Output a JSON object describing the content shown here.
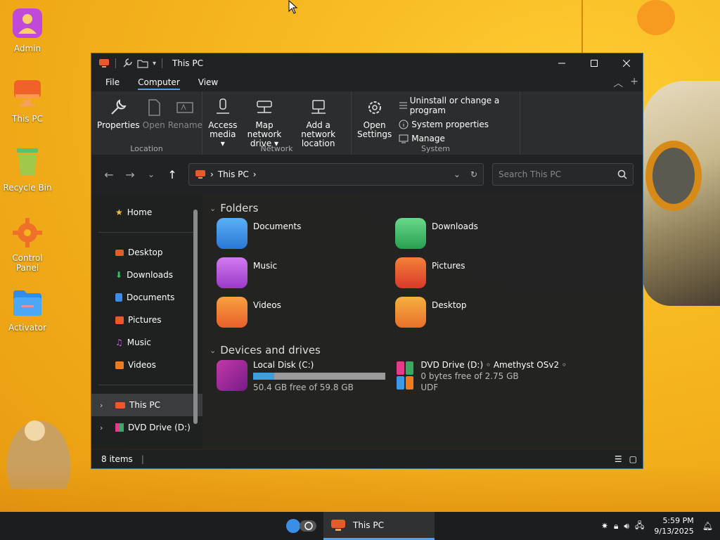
{
  "desktop": {
    "icons": [
      {
        "label": "Admin",
        "icon": "admin-user-icon"
      },
      {
        "label": "This PC",
        "icon": "computer-icon"
      },
      {
        "label": "Recycle Bin",
        "icon": "recycle-bin-icon"
      },
      {
        "label": "Control Panel",
        "icon": "control-panel-gear-icon"
      },
      {
        "label": "Activator",
        "icon": "folder-icon"
      }
    ]
  },
  "window": {
    "title": "This PC",
    "menu": {
      "file": "File",
      "computer": "Computer",
      "view": "View"
    },
    "ribbon": {
      "location": {
        "label": "Location",
        "properties": "Properties",
        "open": "Open",
        "rename": "Rename"
      },
      "network": {
        "label": "Network",
        "access_media_1": "Access",
        "access_media_2": "media ▾",
        "map_drive_1": "Map network",
        "map_drive_2": "drive ▾",
        "add_location_1": "Add a network",
        "add_location_2": "location"
      },
      "system": {
        "label": "System",
        "open_settings_1": "Open",
        "open_settings_2": "Settings",
        "uninstall": "Uninstall or change a program",
        "properties": "System properties",
        "manage": "Manage"
      }
    },
    "address": {
      "path": "This PC",
      "search_placeholder": "Search This PC"
    },
    "sidebar": {
      "home": "Home",
      "quick": [
        "Desktop",
        "Downloads",
        "Documents",
        "Pictures",
        "Music",
        "Videos"
      ],
      "this_pc": "This PC",
      "dvd": "DVD Drive (D:)"
    },
    "content": {
      "folders_header": "Folders",
      "folders": [
        {
          "name": "Documents",
          "color": "#3a8ee6"
        },
        {
          "name": "Downloads",
          "color": "#3cbf6a"
        },
        {
          "name": "Music",
          "color": "#b64fd8"
        },
        {
          "name": "Pictures",
          "color": "#e85a2a"
        },
        {
          "name": "Videos",
          "color": "#f07a1e"
        },
        {
          "name": "Desktop",
          "color": "#e8a020"
        }
      ],
      "drives_header": "Devices and drives",
      "drives": [
        {
          "name": "Local Disk (C:)",
          "detail": "50.4 GB free of 59.8 GB",
          "used_fraction": 0.157
        },
        {
          "name": "DVD Drive (D:) ◦ Amethyst OSv2 ◦",
          "detail": "0 bytes free of 2.75 GB",
          "detail2": "UDF"
        }
      ]
    },
    "status": {
      "items": "8 items"
    }
  },
  "taskbar": {
    "app_label": "This PC",
    "time": "5:59 PM",
    "date": "9/13/2025"
  },
  "colors": {
    "accent": "#4fa0e8",
    "window_bg": "#1f2121",
    "desktop": "#f5b51e"
  }
}
